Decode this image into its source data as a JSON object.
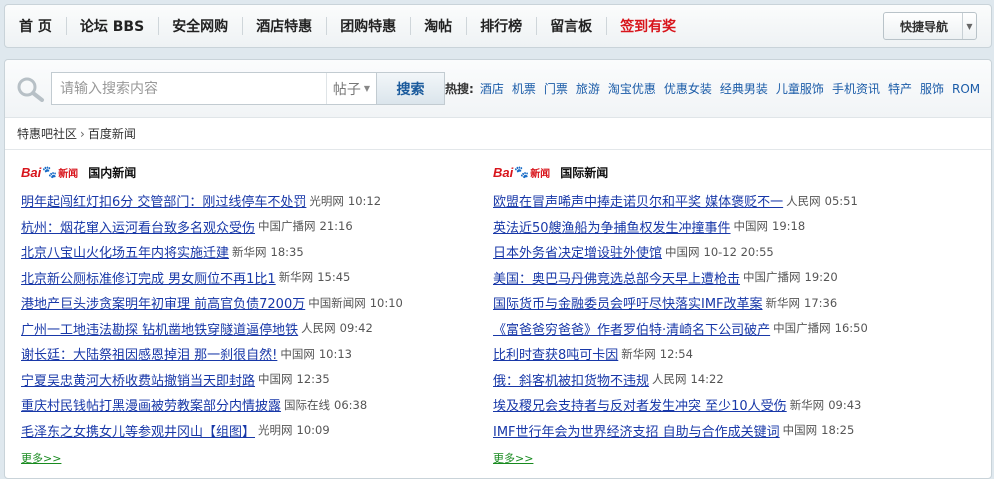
{
  "nav": {
    "items": [
      {
        "label": "首 页",
        "highlight": false
      },
      {
        "label": "论坛 BBS",
        "highlight": false
      },
      {
        "label": "安全网购",
        "highlight": false
      },
      {
        "label": "酒店特惠",
        "highlight": false
      },
      {
        "label": "团购特惠",
        "highlight": false
      },
      {
        "label": "淘帖",
        "highlight": false
      },
      {
        "label": "排行榜",
        "highlight": false
      },
      {
        "label": "留言板",
        "highlight": false
      },
      {
        "label": "签到有奖",
        "highlight": true
      }
    ],
    "quick_nav_label": "快捷导航"
  },
  "search": {
    "placeholder": "请输入搜索内容",
    "type_label": "帖子",
    "button_label": "搜索"
  },
  "hot": {
    "label": "热搜:",
    "links": [
      "酒店",
      "机票",
      "门票",
      "旅游",
      "淘宝优惠",
      "优惠女装",
      "经典男装",
      "儿童服饰",
      "手机资讯",
      "特产",
      "服饰",
      "ROM"
    ]
  },
  "breadcrumb": {
    "items": [
      "特惠吧社区",
      "百度新闻"
    ],
    "separator": "›"
  },
  "columns": [
    {
      "logo": {
        "bai": "Bai",
        "paw": "🐾",
        "news": "新闻"
      },
      "title": "国内新闻",
      "items": [
        {
          "title": "明年起闯红灯扣6分 交管部门：刚过线停车不处罚",
          "source": "光明网",
          "time": "10:12"
        },
        {
          "title": "杭州：烟花窜入运河看台致多名观众受伤",
          "source": "中国广播网",
          "time": "21:16"
        },
        {
          "title": "北京八宝山火化场五年内将实施迁建",
          "source": "新华网",
          "time": "18:35"
        },
        {
          "title": "北京新公厕标准修订完成 男女厕位不再1比1",
          "source": "新华网",
          "time": "15:45"
        },
        {
          "title": "港地产巨头涉贪案明年初审理 前高官负债7200万",
          "source": "中国新闻网",
          "time": "10:10"
        },
        {
          "title": "广州一工地违法勘探 钻机凿地铁穿隧道逼停地铁",
          "source": "人民网",
          "time": "09:42"
        },
        {
          "title": "谢长廷：大陆祭祖因感恩掉泪 那一刹很自然!",
          "source": "中国网",
          "time": "10:13"
        },
        {
          "title": "宁夏吴忠黄河大桥收费站撤销当天即封路",
          "source": "中国网",
          "time": "12:35"
        },
        {
          "title": "重庆村民钱帖打黑漫画被劳教案部分内情披露",
          "source": "国际在线",
          "time": "06:38"
        },
        {
          "title": "毛泽东之女携女儿等参观井冈山【组图】",
          "source": "光明网",
          "time": "10:09"
        }
      ],
      "more": "更多>>"
    },
    {
      "logo": {
        "bai": "Bai",
        "paw": "🐾",
        "news": "新闻"
      },
      "title": "国际新闻",
      "items": [
        {
          "title": "欧盟在冒声唏声中捧走诺贝尔和平奖 媒体褒贬不一",
          "source": "人民网",
          "time": "05:51"
        },
        {
          "title": "英法近50艘渔船为争捕鱼权发生冲撞事件",
          "source": "中国网",
          "time": "19:18"
        },
        {
          "title": "日本外务省决定增设驻外使馆",
          "source": "中国网",
          "time": "10-12 20:55"
        },
        {
          "title": "美国：奥巴马丹佛竞选总部今天早上遭枪击",
          "source": "中国广播网",
          "time": "19:20"
        },
        {
          "title": "国际货币与金融委员会呼吁尽快落实IMF改革案",
          "source": "新华网",
          "time": "17:36"
        },
        {
          "title": "《富爸爸穷爸爸》作者罗伯特·清崎名下公司破产",
          "source": "中国广播网",
          "time": "16:50"
        },
        {
          "title": "比利时查获8吨可卡因",
          "source": "新华网",
          "time": "12:54"
        },
        {
          "title": "俄：斜客机被扣货物不违规",
          "source": "人民网",
          "time": "14:22"
        },
        {
          "title": "埃及稷兄会支持者与反对者发生冲突 至少10人受伤",
          "source": "新华网",
          "time": "09:43"
        },
        {
          "title": "IMF世行年会为世界经济支招 自助与合作成关键词",
          "source": "中国网",
          "time": "18:25"
        }
      ],
      "more": "更多>>"
    }
  ],
  "colors": {
    "link": "#1838a8",
    "highlight": "#d8141b",
    "more": "#188a1f",
    "background": "#dfe8ee"
  }
}
